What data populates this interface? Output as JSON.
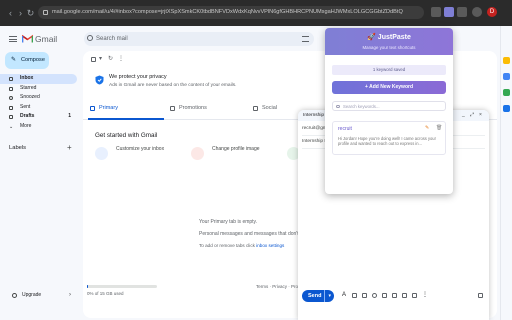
{
  "browser": {
    "url": "mail.google.com/mail/u/4/#inbox?compose=jrjtXSpXSmkCK0tbdBNFVDxWdxKqNvvVPlN6gfGHBHRCPNUMsgaHJWMxLOLGCGGbtZDdBtQ",
    "profile_initial": "D"
  },
  "gmail": {
    "brand": "Gmail",
    "search_placeholder": "Search mail",
    "compose_label": "Compose",
    "nav": [
      {
        "label": "Inbox",
        "active": true
      },
      {
        "label": "Starred"
      },
      {
        "label": "Snoozed"
      },
      {
        "label": "Sent"
      },
      {
        "label": "Drafts",
        "count": "1"
      },
      {
        "label": "More"
      }
    ],
    "labels_heading": "Labels",
    "upgrade_label": "Upgrade",
    "privacy_title": "We protect your privacy",
    "privacy_body": "Ads in Gmail are never based on the content of your emails.",
    "tabs": [
      "Primary",
      "Promotions",
      "Social"
    ],
    "started_title": "Get started with Gmail",
    "cards": [
      {
        "label": "Customize your inbox"
      },
      {
        "label": "Change profile image"
      }
    ],
    "empty_title": "Your Primary tab is empty.",
    "empty_body": "Personal messages and messages that don't appear in other tabs will be shown here.",
    "empty_hint_prefix": "To add or remove tabs click",
    "empty_hint_link": "inbox settings",
    "storage_used": 0.02,
    "storage_label": "0% of 15 GB used",
    "terms": "Terms · Privacy · Program Policies"
  },
  "compose_window": {
    "title": "Internship",
    "to": "recruit@gmail.com",
    "subject": "Internship Req",
    "send_label": "Send"
  },
  "popup": {
    "title": "JustPaste",
    "subtitle": "Manage your text shortcuts",
    "count_text": "1 keyword saved",
    "add_label": "+ Add New Keyword",
    "search_placeholder": "Search keywords...",
    "entry_keyword": "recruit",
    "entry_text": "Hi Jordan! Hope you're doing well! I came across your profile and wanted to reach out to express in..."
  },
  "colors": {
    "accent": "#0b57d0",
    "compose_bg": "#c2e7ff",
    "popup_gradient_start": "#7f7fd5",
    "popup_gradient_end": "#8e75d8"
  }
}
